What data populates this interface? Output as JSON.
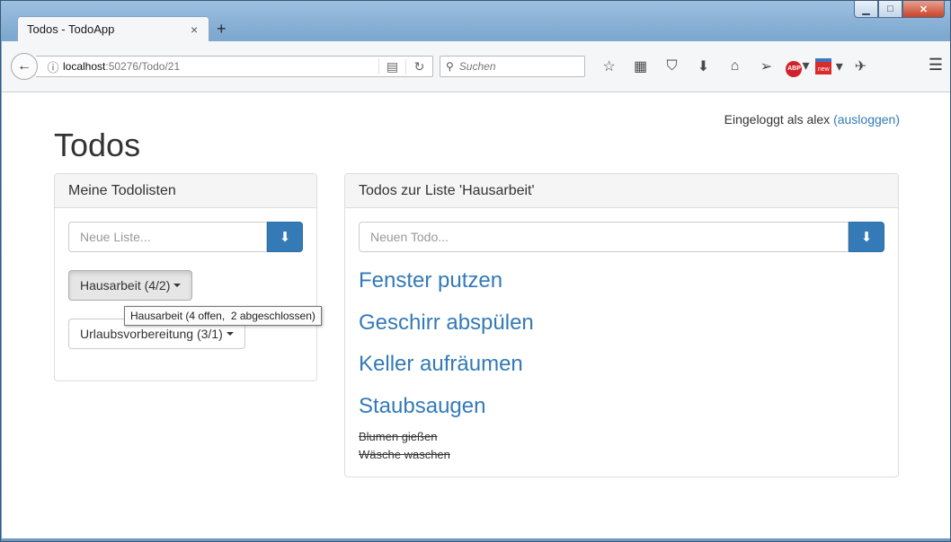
{
  "browser": {
    "tab_title": "Todos - TodoApp",
    "tab_close": "×",
    "new_tab": "+",
    "url_host": "localhost",
    "url_rest": ":50276/Todo/21",
    "search_placeholder": "Suchen",
    "window_controls": {
      "minimize": "▁",
      "maximize": "□",
      "close": "✕"
    },
    "toolbar_icons": [
      "bookmark-star-icon",
      "reading-list-icon",
      "pocket-icon",
      "download-icon",
      "home-icon",
      "send-icon",
      "adblock-plus-icon",
      "new-badge-icon",
      "extension-icon"
    ],
    "abp_label": "ABP",
    "new_label": "new"
  },
  "page": {
    "login_text": "Eingeloggt als alex",
    "logout_link": "(ausloggen)",
    "title": "Todos"
  },
  "lists_panel": {
    "heading": "Meine Todolisten",
    "new_list_placeholder": "Neue Liste...",
    "lists": [
      {
        "label": "Hausarbeit (4/2)",
        "active": true
      },
      {
        "label": "Urlaubsvorbereitung (3/1)",
        "active": false
      }
    ],
    "tooltip": "Hausarbeit (4 offen,  2 abgeschlossen)"
  },
  "todos_panel": {
    "heading": "Todos zur Liste 'Hausarbeit'",
    "new_todo_placeholder": "Neuen Todo...",
    "open_todos": [
      "Fenster putzen",
      "Geschirr abspülen",
      "Keller aufräumen",
      "Staubsaugen"
    ],
    "done_todos": [
      "Blumen gießen",
      "Wäsche waschen"
    ]
  },
  "colors": {
    "primary": "#337ab7",
    "panel_heading_bg": "#f5f5f5"
  }
}
